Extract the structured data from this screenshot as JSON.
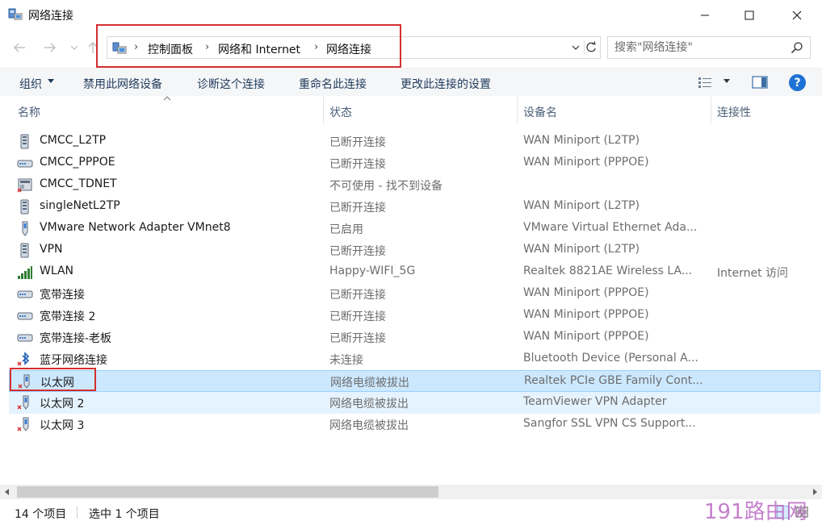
{
  "window": {
    "title": "网络连接",
    "min_label": "—",
    "max_label": "☐",
    "close_label": "✕"
  },
  "address": {
    "crumbs": [
      "控制面板",
      "网络和 Internet",
      "网络连接"
    ],
    "separator": "›",
    "back_glyph": "←",
    "forward_glyph": "→",
    "recent_glyph": "⌄",
    "up_glyph": "↑",
    "dropdown_glyph": "⌄",
    "refresh_glyph": "↻"
  },
  "search": {
    "placeholder": "搜索\"网络连接\""
  },
  "commands": {
    "organize": "组织",
    "disable": "禁用此网络设备",
    "diagnose": "诊断这个连接",
    "rename": "重命名此连接",
    "change_settings": "更改此连接的设置",
    "help": "?"
  },
  "columns": {
    "name": "名称",
    "status": "状态",
    "device": "设备名",
    "connectivity": "连接性"
  },
  "rows": [
    {
      "name": "CMCC_L2TP",
      "status": "已断开连接",
      "device": "WAN Miniport (L2TP)",
      "conn": "",
      "icon": "vpn-icon"
    },
    {
      "name": "CMCC_PPPOE",
      "status": "已断开连接",
      "device": "WAN Miniport (PPPOE)",
      "conn": "",
      "icon": "broadband-icon"
    },
    {
      "name": "CMCC_TDNET",
      "status": "不可使用 - 找不到设备",
      "device": "",
      "conn": "",
      "icon": "modem-disabled-icon"
    },
    {
      "name": "singleNetL2TP",
      "status": "已断开连接",
      "device": "WAN Miniport (L2TP)",
      "conn": "",
      "icon": "vpn-icon"
    },
    {
      "name": "VMware Network Adapter VMnet8",
      "status": "已启用",
      "device": "VMware Virtual Ethernet Ada...",
      "conn": "",
      "icon": "ethernet-icon"
    },
    {
      "name": "VPN",
      "status": "已断开连接",
      "device": "WAN Miniport (L2TP)",
      "conn": "",
      "icon": "vpn-icon"
    },
    {
      "name": "WLAN",
      "status": "Happy-WIFI_5G",
      "device": "Realtek 8821AE Wireless LA...",
      "conn": "Internet 访问",
      "icon": "wifi-signal-icon"
    },
    {
      "name": "宽带连接",
      "status": "已断开连接",
      "device": "WAN Miniport (PPPOE)",
      "conn": "",
      "icon": "broadband-icon"
    },
    {
      "name": "宽带连接 2",
      "status": "已断开连接",
      "device": "WAN Miniport (PPPOE)",
      "conn": "",
      "icon": "broadband-icon"
    },
    {
      "name": "宽带连接-老板",
      "status": "已断开连接",
      "device": "WAN Miniport (PPPOE)",
      "conn": "",
      "icon": "broadband-icon"
    },
    {
      "name": "蓝牙网络连接",
      "status": "未连接",
      "device": "Bluetooth Device (Personal A...",
      "conn": "",
      "icon": "bluetooth-disconnected-icon"
    },
    {
      "name": "以太网",
      "status": "网络电缆被拔出",
      "device": "Realtek PCIe GBE Family Cont...",
      "conn": "",
      "icon": "ethernet-unplugged-icon"
    },
    {
      "name": "以太网 2",
      "status": "网络电缆被拔出",
      "device": "TeamViewer VPN Adapter",
      "conn": "",
      "icon": "ethernet-unplugged-icon"
    },
    {
      "name": "以太网 3",
      "status": "网络电缆被拔出",
      "device": "Sangfor SSL VPN CS Support...",
      "conn": "",
      "icon": "ethernet-unplugged-icon"
    }
  ],
  "statusbar": {
    "count": "14 个项目",
    "selected": "选中 1 个项目"
  },
  "watermark": "191路由网",
  "colors": {
    "selection": "#cce8ff",
    "hover": "#e5f3ff",
    "highlight_box": "#d32f2f",
    "help": "#1e72d6",
    "watermark": "#ba6cc4"
  }
}
